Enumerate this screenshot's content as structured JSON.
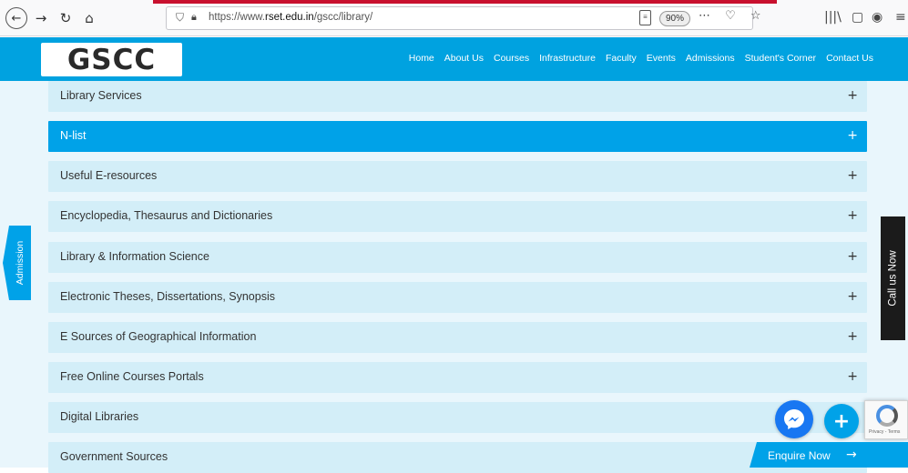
{
  "browser": {
    "url_prefix": "https://www.",
    "url_domain": "rset.edu.in",
    "url_path": "/gscc/library/",
    "zoom": "90%",
    "back_icon": "←",
    "forward_icon": "→",
    "reload_icon": "↻",
    "home_icon": "⌂",
    "page_actions": "⋯ ♡ ☆",
    "library_icon": "|||\\",
    "sidebar_icon": "▢",
    "account_icon": "◉",
    "menu_icon": "≡"
  },
  "site": {
    "logo": "GSCC",
    "nav": [
      "Home",
      "About Us",
      "Courses",
      "Infrastructure",
      "Faculty",
      "Events",
      "Admissions",
      "Student's Corner",
      "Contact Us"
    ]
  },
  "accordion": {
    "items": [
      {
        "label": "Library Services",
        "icon": "+"
      },
      {
        "label": "N-list",
        "icon": "+"
      },
      {
        "label": "Useful E-resources",
        "icon": "+"
      },
      {
        "label": "Encyclopedia, Thesaurus and Dictionaries",
        "icon": "+"
      },
      {
        "label": "Library & Information Science",
        "icon": "+"
      },
      {
        "label": "Electronic Theses, Dissertations, Synopsis",
        "icon": "+"
      },
      {
        "label": "E Sources of Geographical Information",
        "icon": "+"
      },
      {
        "label": "Free Online Courses Portals",
        "icon": "+"
      },
      {
        "label": "Digital Libraries",
        "icon": ""
      },
      {
        "label": "Government Sources",
        "icon": ""
      }
    ]
  },
  "side": {
    "admission": "Admission",
    "call_us": "Call us Now"
  },
  "widgets": {
    "plus": "+",
    "recaptcha_text": "Privacy - Terms",
    "enquire": "Enquire Now",
    "enquire_arrow": "→"
  },
  "colors": {
    "brand_blue": "#00a2e8",
    "row_bg": "#d3eef8",
    "active_row": "#00a2e8"
  }
}
